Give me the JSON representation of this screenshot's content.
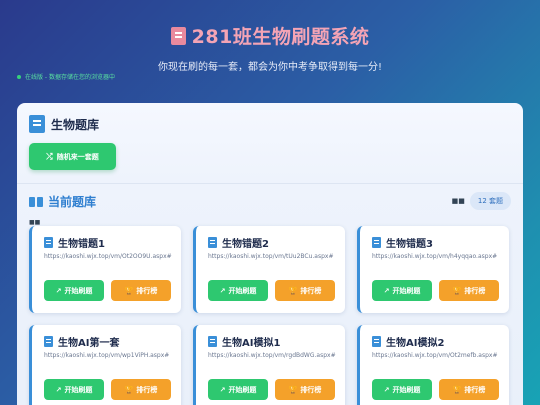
{
  "header": {
    "title": "281班生物刷题系统",
    "subtitle": "你现在刷的每一套，都会为你中考争取得到每一分!"
  },
  "status": {
    "text": "在线版 - 数据存储在您的浏览器中",
    "color": "#36d07a"
  },
  "panel": {
    "title": "生物题库",
    "random_button": "随机来一套题",
    "section_title": "当前题库",
    "count_badge": "12 套题",
    "mini_mark": "■■"
  },
  "icons": {
    "title": "book-icon",
    "shuffle": "shuffle-icon",
    "start": "external-link-icon",
    "rank": "trophy-icon"
  },
  "cards": [
    {
      "title": "生物错题1",
      "url": "https://kaoshi.wjx.top/vm/Ot2OO9U.aspx#",
      "start_label": "开始刷题",
      "rank_label": "排行榜"
    },
    {
      "title": "生物错题2",
      "url": "https://kaoshi.wjx.top/vm/tUu2BCu.aspx#",
      "start_label": "开始刷题",
      "rank_label": "排行榜"
    },
    {
      "title": "生物错题3",
      "url": "https://kaoshi.wjx.top/vm/h4yqqao.aspx#",
      "start_label": "开始刷题",
      "rank_label": "排行榜"
    },
    {
      "title": "生物AI第一套",
      "url": "https://kaoshi.wjx.top/vm/wp1ViPH.aspx#",
      "start_label": "开始刷题",
      "rank_label": "排行榜"
    },
    {
      "title": "生物AI模拟1",
      "url": "https://kaoshi.wjx.top/vm/rgdBdWG.aspx#",
      "start_label": "开始刷题",
      "rank_label": "排行榜"
    },
    {
      "title": "生物AI模拟2",
      "url": "https://kaoshi.wjx.top/vm/Ot2mefb.aspx#",
      "start_label": "开始刷题",
      "rank_label": "排行榜"
    }
  ],
  "colors": {
    "accent": "#3a8fd8",
    "start": "#2ec870",
    "rank": "#f4a12a",
    "title": "#f4a4b5"
  }
}
